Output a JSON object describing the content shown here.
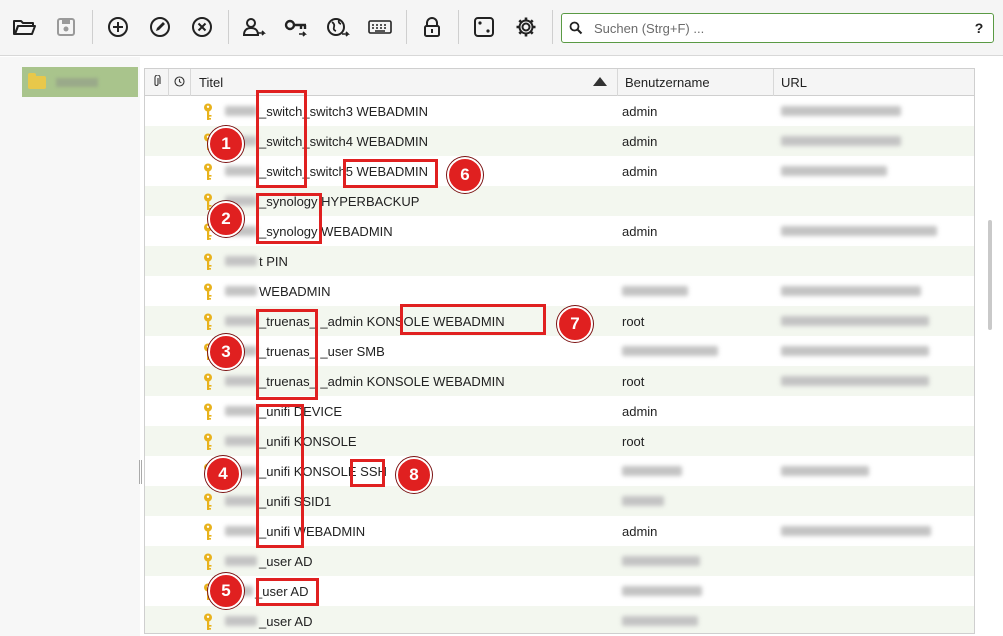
{
  "toolbar": {
    "search_placeholder": "Suchen (Strg+F) ...",
    "help_label": "?",
    "icons": [
      "open-database-icon",
      "save-database-icon",
      "add-entry-icon",
      "edit-entry-icon",
      "delete-entry-icon",
      "copy-username-icon",
      "copy-password-icon",
      "open-url-icon",
      "autotype-icon",
      "lock-icon",
      "password-generator-icon",
      "settings-icon"
    ]
  },
  "table": {
    "headers": {
      "attachment": "",
      "expires": "",
      "title": "Titel",
      "username": "Benutzername",
      "url": "URL"
    },
    "rows": [
      {
        "title": "_switch_switch3 WEBADMIN",
        "username": "admin"
      },
      {
        "title": "_switch_switch4 WEBADMIN",
        "username": "admin"
      },
      {
        "title": "_switch_switch5 WEBADMIN",
        "username": "admin"
      },
      {
        "title": "_synology HYPERBACKUP",
        "username": ""
      },
      {
        "title": "_synology WEBADMIN",
        "username": "admin"
      },
      {
        "title": "t PIN",
        "username": ""
      },
      {
        "title": "WEBADMIN",
        "username": ""
      },
      {
        "title": "_truenas_ _admin KONSOLE WEBADMIN",
        "username": "root"
      },
      {
        "title": "_truenas_ _user SMB",
        "username": ""
      },
      {
        "title": "_truenas_ _admin KONSOLE WEBADMIN",
        "username": "root"
      },
      {
        "title": "_unifi DEVICE",
        "username": "admin"
      },
      {
        "title": "_unifi KONSOLE",
        "username": "root"
      },
      {
        "title": "_unifi KONSOLE SSH",
        "username": ""
      },
      {
        "title": "_unifi SSID1",
        "username": ""
      },
      {
        "title": "_unifi WEBADMIN",
        "username": "admin"
      },
      {
        "title": "_user AD",
        "username": ""
      },
      {
        "title": "_user AD",
        "username": ""
      },
      {
        "title": "_user AD",
        "username": ""
      }
    ]
  },
  "annotations": [
    "1",
    "2",
    "3",
    "4",
    "5",
    "6",
    "7",
    "8"
  ],
  "colors": {
    "annotation": "#e02020",
    "selection": "#a9c48c",
    "key": "#e8b21c",
    "alt_row": "#f3f7ef"
  }
}
